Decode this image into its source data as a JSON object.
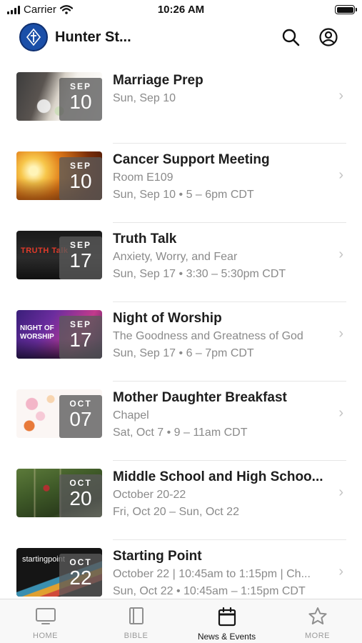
{
  "status_bar": {
    "carrier": "Carrier",
    "time": "10:26 AM"
  },
  "header": {
    "title": "Hunter St..."
  },
  "events": [
    {
      "title": "Marriage Prep",
      "lines": [
        "Sun, Sep 10"
      ],
      "month": "SEP",
      "day": "10",
      "thumb_label": ""
    },
    {
      "title": "Cancer Support Meeting",
      "lines": [
        "Room E109",
        "Sun, Sep 10 • 5 – 6pm CDT"
      ],
      "month": "SEP",
      "day": "10",
      "thumb_label": ""
    },
    {
      "title": "Truth Talk",
      "lines": [
        "Anxiety, Worry, and Fear",
        "Sun, Sep 17 • 3:30 – 5:30pm CDT"
      ],
      "month": "SEP",
      "day": "17",
      "thumb_label": "TRUTH Talk"
    },
    {
      "title": "Night of Worship",
      "lines": [
        "The Goodness and Greatness of God",
        "Sun, Sep 17 • 6 – 7pm CDT"
      ],
      "month": "SEP",
      "day": "17",
      "thumb_label": "NIGHT OF WORSHIP"
    },
    {
      "title": "Mother Daughter Breakfast",
      "lines": [
        "Chapel",
        "Sat, Oct 7 • 9 – 11am CDT"
      ],
      "month": "OCT",
      "day": "07",
      "thumb_label": ""
    },
    {
      "title": "Middle School and High Schoo...",
      "lines": [
        "October 20-22",
        "Fri, Oct 20 – Sun, Oct 22"
      ],
      "month": "OCT",
      "day": "20",
      "thumb_label": ""
    },
    {
      "title": "Starting Point",
      "lines": [
        "October 22 | 10:45am to 1:15pm | Ch...",
        "Sun, Oct 22 • 10:45am – 1:15pm CDT"
      ],
      "month": "OCT",
      "day": "22",
      "thumb_label": "startingpoint"
    }
  ],
  "tabs": [
    {
      "label": "HOME",
      "icon": "monitor-icon",
      "active": false
    },
    {
      "label": "BIBLE",
      "icon": "book-icon",
      "active": false
    },
    {
      "label": "News & Events",
      "icon": "calendar-icon",
      "active": true
    },
    {
      "label": "MORE",
      "icon": "star-icon",
      "active": false
    }
  ],
  "colors": {
    "brand_blue": "#1b4fa8",
    "muted_text": "#8a8a8a",
    "badge_bg": "#5a5a5a"
  }
}
